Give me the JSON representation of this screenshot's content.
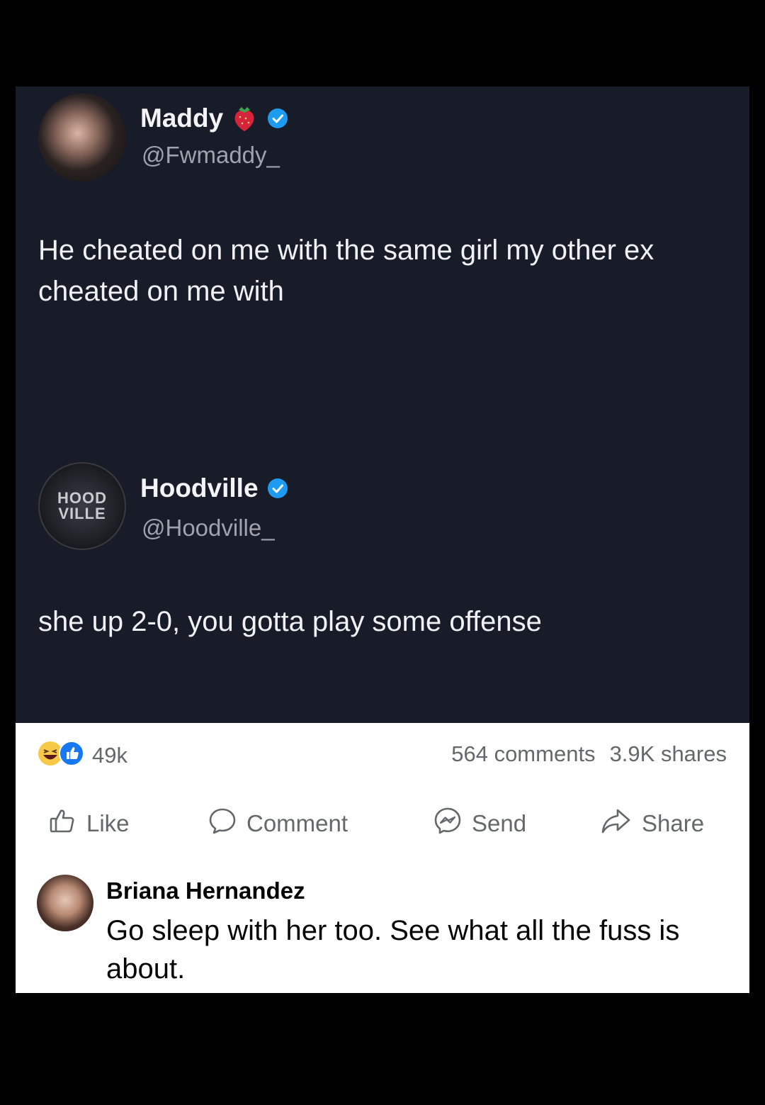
{
  "tweet1": {
    "name": "Maddy",
    "handle": "@Fwmaddy_",
    "text": "He cheated on me with the same girl my other ex cheated on me with",
    "avatar_icon": "profile-photo",
    "badge_icons": [
      "strawberry-emoji",
      "verified-badge"
    ]
  },
  "tweet2": {
    "name": "Hoodville",
    "handle": "@Hoodville_",
    "text": "she up 2-0, you gotta play some offense",
    "avatar_icon": "hoodville-logo",
    "avatar_logo_text": "HOOD VILLE",
    "badge_icons": [
      "verified-badge"
    ]
  },
  "facebook": {
    "reaction_icons": [
      "haha-reaction",
      "like-reaction"
    ],
    "reaction_count": "49k",
    "comments_count": "564 comments",
    "shares_count": "3.9K shares",
    "actions": [
      {
        "label": "Like",
        "icon": "thumbs-up-icon"
      },
      {
        "label": "Comment",
        "icon": "comment-bubble-icon"
      },
      {
        "label": "Send",
        "icon": "messenger-icon"
      },
      {
        "label": "Share",
        "icon": "share-arrow-icon"
      }
    ],
    "comment": {
      "author": "Briana Hernandez",
      "text": "Go sleep with her too. See what all the fuss is about."
    }
  },
  "colors": {
    "dark_bg": "#181b28",
    "verified_blue": "#1d9bf0",
    "fb_blue": "#1877f2",
    "muted_text": "#65676b"
  }
}
